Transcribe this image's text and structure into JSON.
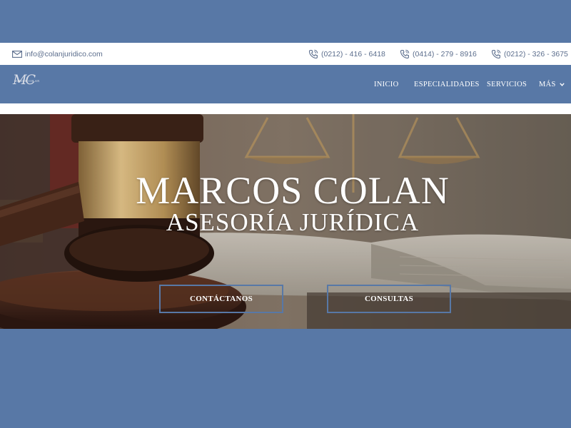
{
  "topbar": {
    "email": "info@colanjuridico.com",
    "phones": [
      "(0212) - 416 - 6418",
      "(0414) - 279 - 8916",
      "(0212) - 326 - 3675"
    ]
  },
  "brand": {
    "monogram": "MC",
    "name": "MARCOS COLAN"
  },
  "nav": {
    "items": [
      "INICIO",
      "ESPECIALIDADES",
      "SERVICIOS",
      "MÁS"
    ]
  },
  "hero": {
    "title": "MARCOS COLAN",
    "subtitle": "ASESORÍA JURÍDICA",
    "buttons": [
      "CONTÁCTANOS",
      "CONSULTAS"
    ]
  },
  "colors": {
    "accent": "#5878a6",
    "topbar_text": "#5b6d8c"
  },
  "icons": {
    "email": "envelope-icon",
    "phone": "phone-icon",
    "dropdown": "chevron-down-icon"
  }
}
